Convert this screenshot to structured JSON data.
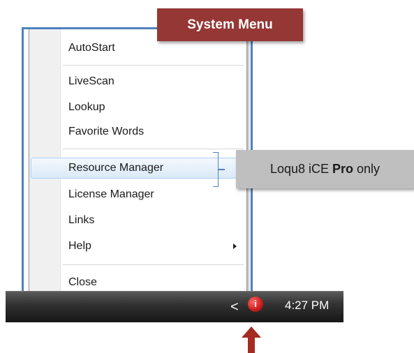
{
  "callouts": {
    "system_menu": "System Menu",
    "pro_only_prefix": "Loqu8 iCE",
    "pro_only_bold": "Pro",
    "pro_only_suffix": "only"
  },
  "menu": {
    "items": [
      {
        "label": "AutoStart"
      },
      {
        "label": "LiveScan"
      },
      {
        "label": "Lookup"
      },
      {
        "label": "Favorite Words"
      },
      {
        "label": "Resource Manager",
        "highlighted": true
      },
      {
        "label": "License Manager"
      },
      {
        "label": "Links"
      },
      {
        "label": "Help",
        "has_submenu": true
      },
      {
        "label": "Close"
      }
    ]
  },
  "taskbar": {
    "chevron": "<",
    "tray_icon": "app-tray-icon",
    "tray_icon_glyph": "i",
    "clock": "4:27 PM"
  },
  "colors": {
    "menu_outline": "#4f81bd",
    "system_callout_bg": "#953735",
    "pro_callout_bg": "#bfbfbf",
    "arrow": "#a52a22",
    "highlight_border": "#aecff7"
  }
}
